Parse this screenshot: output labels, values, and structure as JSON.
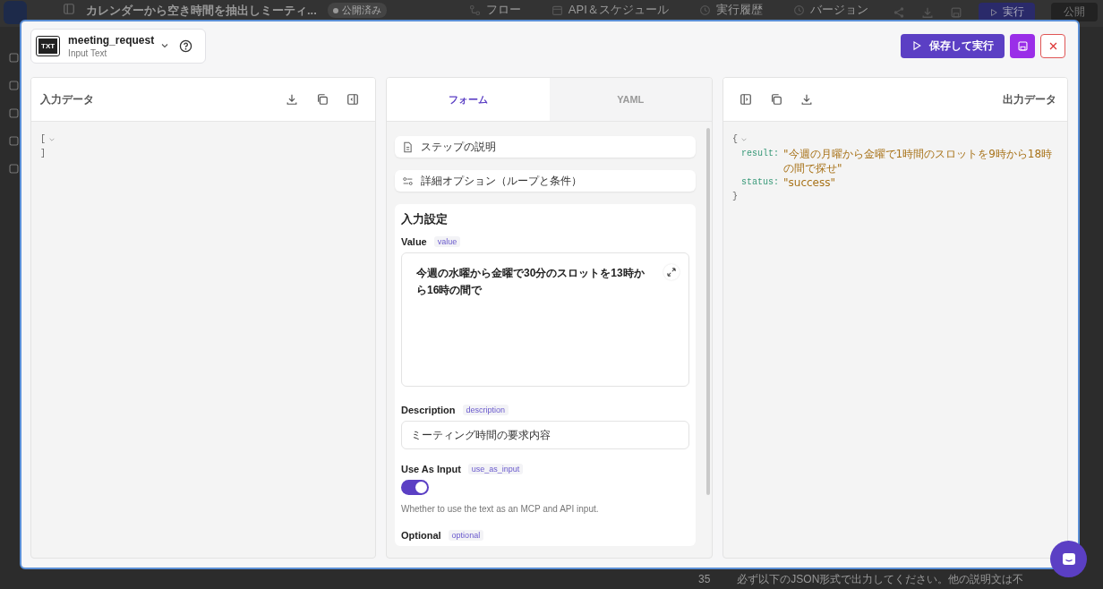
{
  "app": {
    "title": "カレンダーから空き時間を抽出しミーティ...",
    "status_badge": "公開済み",
    "nav": [
      {
        "label": "フロー"
      },
      {
        "label": "API＆スケジュール"
      },
      {
        "label": "実行履歴"
      },
      {
        "label": "バージョン"
      }
    ],
    "run_button": "実行",
    "publish_button": "公開",
    "footer_number": "35",
    "footer_text": "必ず以下のJSON形式で出力してください。他の説明文は不"
  },
  "modal": {
    "step_name": "meeting_request",
    "step_type": "Input Text",
    "file_icon_label": "TXT",
    "run_button": "保存して実行",
    "input_panel": {
      "title": "入力データ",
      "open": "[",
      "close": "]"
    },
    "tabs": [
      {
        "label": "フォーム",
        "selected": true
      },
      {
        "label": "YAML",
        "selected": false
      }
    ],
    "sections": [
      {
        "label": "ステップの説明",
        "kind": "doc"
      },
      {
        "label": "詳細オプション（ループと条件）",
        "kind": "options"
      }
    ],
    "settings": {
      "title": "入力設定",
      "fields": [
        {
          "kind": "textarea",
          "label": "Value",
          "key": "value",
          "value": "今週の水曜から金曜で30分のスロットを13時から16時の間で"
        },
        {
          "kind": "text",
          "label": "Description",
          "key": "description",
          "value": "ミーティング時間の要求内容"
        },
        {
          "kind": "toggle",
          "label": "Use As Input",
          "key": "use_as_input",
          "on": true,
          "help": "Whether to use the text as an MCP and API input."
        },
        {
          "kind": "header",
          "label": "Optional",
          "key": "optional"
        }
      ]
    },
    "output_panel": {
      "title": "出力データ",
      "open": "{",
      "close": "}",
      "entries": [
        {
          "key": "result:",
          "value": "\"今週の月曜から金曜で1時間のスロットを9時から18時の間で探せ\""
        },
        {
          "key": "status:",
          "value": "\"success\""
        }
      ]
    }
  }
}
